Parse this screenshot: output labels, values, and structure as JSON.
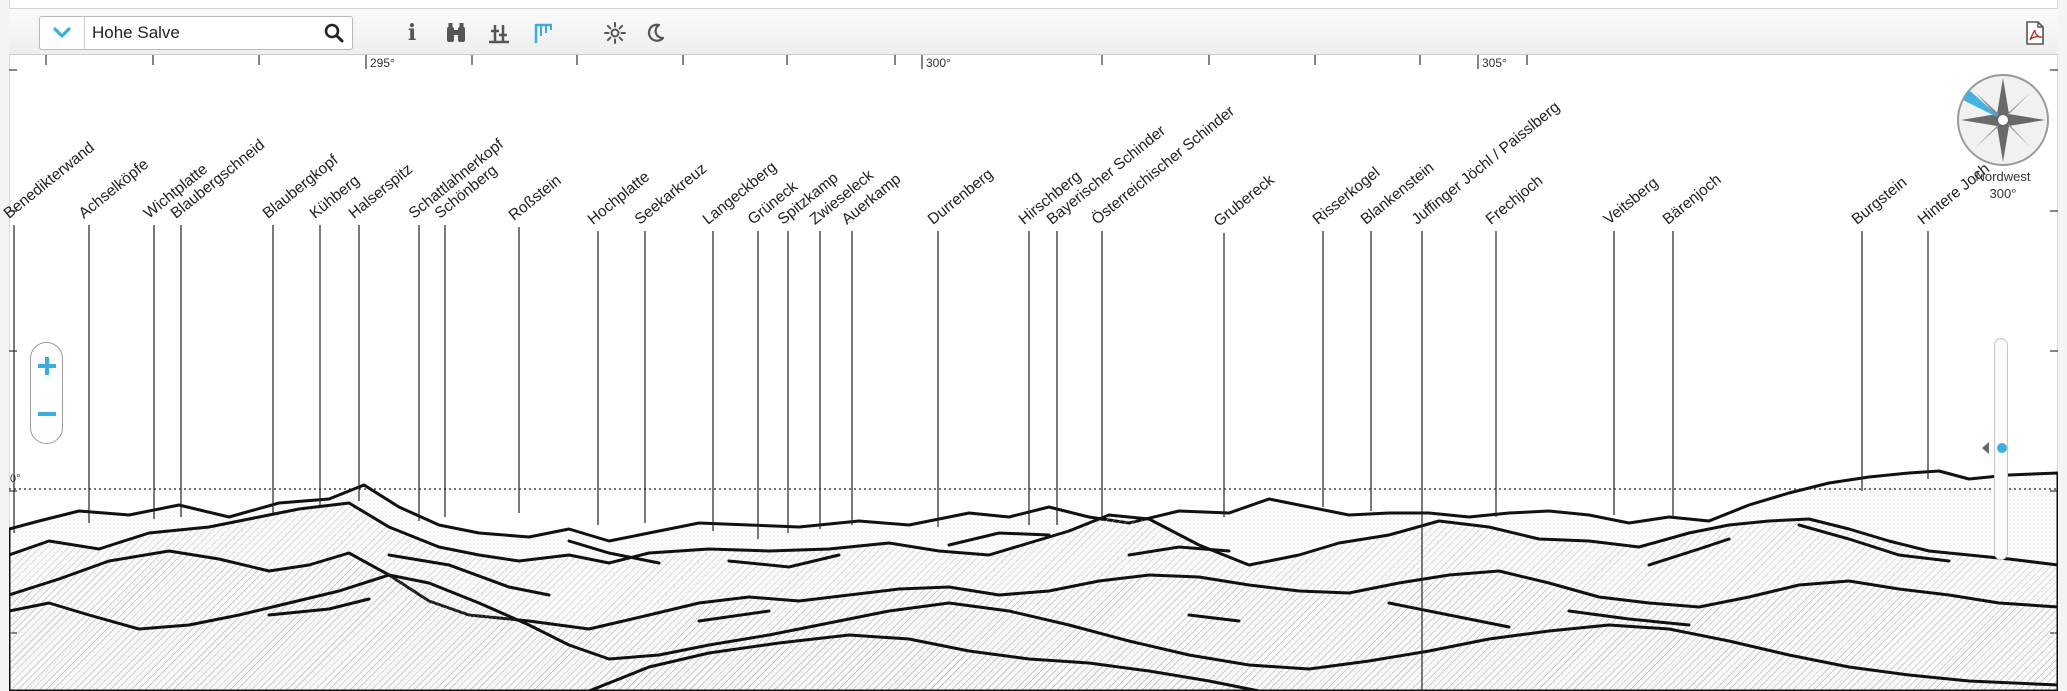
{
  "search": {
    "value": "Hohe Salve",
    "placeholder": ""
  },
  "axis": {
    "degrees": [
      {
        "label": "295°"
      },
      {
        "label": "300°"
      },
      {
        "label": "305°"
      }
    ],
    "horizon_label": "0°"
  },
  "peaks": [
    {
      "name": "Benedikterwand"
    },
    {
      "name": "Achselköpfe"
    },
    {
      "name": "Wichtplatte"
    },
    {
      "name": "Blaubergschneid"
    },
    {
      "name": "Blaubergkopf"
    },
    {
      "name": "Kühberg"
    },
    {
      "name": "Halserspitz"
    },
    {
      "name": "Schattlahnerkopf"
    },
    {
      "name": "Schönberg"
    },
    {
      "name": "Roßstein"
    },
    {
      "name": "Hochplatte"
    },
    {
      "name": "Seekarkreuz"
    },
    {
      "name": "Langeckberg"
    },
    {
      "name": "Grüneck"
    },
    {
      "name": "Spitzkamp"
    },
    {
      "name": "Zwieseleck"
    },
    {
      "name": "Auerkamp"
    },
    {
      "name": "Durrenberg"
    },
    {
      "name": "Hirschberg"
    },
    {
      "name": "Bayerischer Schinder"
    },
    {
      "name": "Österreichischer Schinder"
    },
    {
      "name": "Grubereck"
    },
    {
      "name": "Risserkogel"
    },
    {
      "name": "Blankenstein"
    },
    {
      "name": "Juffinger Jöchl / Paisslberg"
    },
    {
      "name": "Frechjoch"
    },
    {
      "name": "Veitsberg"
    },
    {
      "name": "Bärenjoch"
    },
    {
      "name": "Burgstein"
    },
    {
      "name": "Hintere Joch"
    }
  ],
  "compass": {
    "direction": "Nordwest",
    "heading": "300°"
  },
  "icons": {
    "dropdown": "chevron-down-icon",
    "search": "search-icon",
    "info": "info-icon",
    "binoculars": "binoculars-icon",
    "summit": "summit-icon",
    "peak_labels": "flag-icon",
    "day": "sun-icon",
    "night": "moon-icon",
    "pdf": "pdf-icon",
    "zoom_in": "plus-icon",
    "zoom_out": "minus-icon"
  },
  "colors": {
    "accent": "#3aaee0",
    "line": "#111111",
    "toolbar": "#f0f0f0"
  }
}
